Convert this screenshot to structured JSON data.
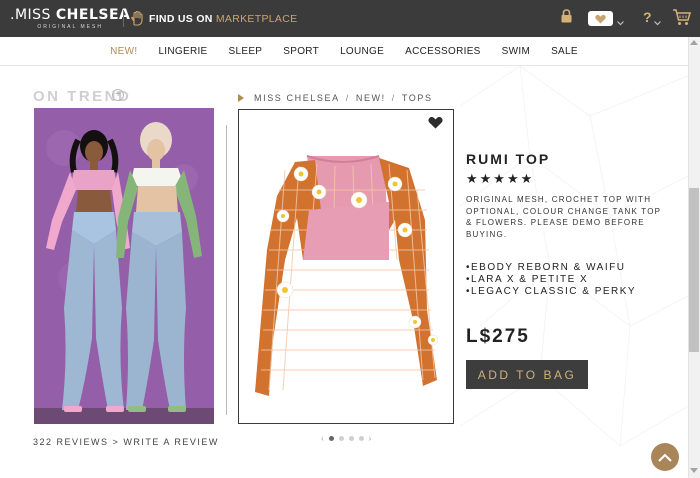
{
  "brand": {
    "logo_light": ".MISS ",
    "logo_bold": "CHELSEA",
    "tagline": "ORIGINAL MESH"
  },
  "header": {
    "find_us": "FIND US ON ",
    "marketplace": "MARKETPLACE",
    "help": "?",
    "accent_color": "#c9a56e"
  },
  "nav": {
    "items": [
      "NEW!",
      "LINGERIE",
      "SLEEP",
      "SPORT",
      "LOUNGE",
      "ACCESSORIES",
      "SWIM",
      "SALE"
    ],
    "active_index": 0
  },
  "on_trend": {
    "label": "ON TREND",
    "plus": "+",
    "reviews": "322 REVIEWS",
    "sep": ">",
    "write": "WRITE A REVIEW"
  },
  "breadcrumb": [
    "MISS CHELSEA",
    "NEW!",
    "TOPS"
  ],
  "breadcrumb_sep": "/",
  "product": {
    "title": "RUMI TOP",
    "stars": "★★★★★",
    "rating": 5,
    "description": "ORIGINAL MESH, CROCHET TOP WITH OPTIONAL, COLOUR CHANGE TANK TOP & FLOWERS. PLEASE DEMO BEFORE BUYING.",
    "bodies": [
      "•EBODY REBORN & WAIFU",
      "•LARA X & PETITE X",
      "•LEGACY CLASSIC & PERKY"
    ],
    "price": "L$275",
    "add_to_bag": "ADD TO BAG"
  },
  "carousel": {
    "prev": "‹",
    "next": "›",
    "active_index": 0
  }
}
